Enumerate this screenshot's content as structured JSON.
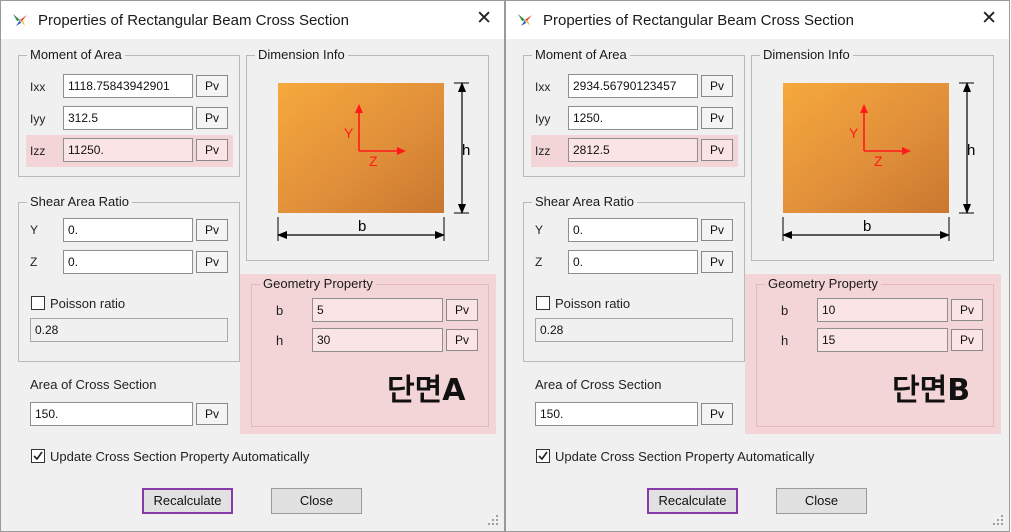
{
  "dialogs": [
    {
      "title": "Properties of Rectangular Beam Cross Section",
      "moment_label": "Moment of Area",
      "ixx_label": "Ixx",
      "ixx": "1118.75843942901",
      "iyy_label": "Iyy",
      "iyy": "312.5",
      "izz_label": "Izz",
      "izz": "11250.",
      "shear_label": "Shear Area Ratio",
      "y_label": "Y",
      "y": "0.",
      "z_label": "Z",
      "z": "0.",
      "poisson_label": "Poisson ratio",
      "poisson": "0.28",
      "area_label": "Area of Cross Section",
      "area": "150.",
      "dim_label": "Dimension Info",
      "axis_y": "Y",
      "axis_z": "Z",
      "dim_h": "h",
      "dim_b": "b",
      "geom_label": "Geometry Property",
      "b_label": "b",
      "b": "5",
      "h_label": "h",
      "h": "30",
      "section_name": "단면A",
      "update_label": "Update Cross Section Property Automatically",
      "recalc": "Recalculate",
      "close": "Close"
    },
    {
      "title": "Properties of Rectangular Beam Cross Section",
      "moment_label": "Moment of Area",
      "ixx_label": "Ixx",
      "ixx": "2934.56790123457",
      "iyy_label": "Iyy",
      "iyy": "1250.",
      "izz_label": "Izz",
      "izz": "2812.5",
      "shear_label": "Shear Area Ratio",
      "y_label": "Y",
      "y": "0.",
      "z_label": "Z",
      "z": "0.",
      "poisson_label": "Poisson ratio",
      "poisson": "0.28",
      "area_label": "Area of Cross Section",
      "area": "150.",
      "dim_label": "Dimension Info",
      "axis_y": "Y",
      "axis_z": "Z",
      "dim_h": "h",
      "dim_b": "b",
      "geom_label": "Geometry Property",
      "b_label": "b",
      "b": "10",
      "h_label": "h",
      "h": "15",
      "section_name": "단면B",
      "update_label": "Update Cross Section Property Automatically",
      "recalc": "Recalculate",
      "close": "Close"
    }
  ],
  "pv_label": "Pv",
  "colors": {
    "highlight": "#f3d5d7",
    "section_fill": "#e0902f",
    "axis": "#ff1a1a",
    "focus_border": "#8a3aa8"
  },
  "icons": {
    "app": "app-logo-icon",
    "close": "close-icon",
    "check": "checkmark-icon",
    "grip": "resize-grip-icon"
  }
}
